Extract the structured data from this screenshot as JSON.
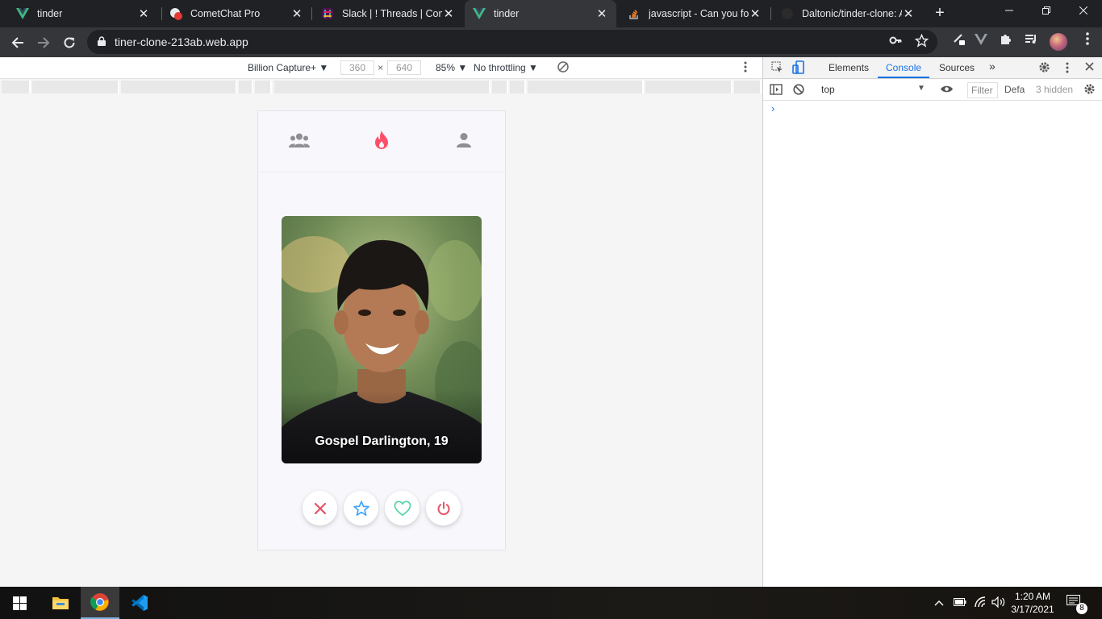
{
  "browser": {
    "tabs": [
      {
        "title": "tinder",
        "icon": "vue-icon",
        "active": false
      },
      {
        "title": "CometChat Pro",
        "icon": "cometchat-icon",
        "active": false
      },
      {
        "title": "Slack | ! Threads | Come",
        "icon": "slack-icon",
        "active": false
      },
      {
        "title": "tinder",
        "icon": "vue-icon",
        "active": true
      },
      {
        "title": "javascript - Can you for",
        "icon": "stackoverflow-icon",
        "active": false
      },
      {
        "title": "Daltonic/tinder-clone: A",
        "icon": "github-icon",
        "active": false
      }
    ],
    "close_glyph": "✕",
    "new_tab_glyph": "+",
    "url": "tiner-clone-213ab.web.app"
  },
  "device_toolbar": {
    "device": "Billion Capture+",
    "width": "360",
    "height": "640",
    "times": "×",
    "zoom": "85%",
    "throttling": "No throttling"
  },
  "app": {
    "card_name": "Gospel Darlington, 19",
    "colors": {
      "brand": "#fd5068",
      "nope": "#e25566",
      "star": "#3ca4ff",
      "like": "#53d3a2",
      "power": "#e25566"
    }
  },
  "devtools": {
    "tabs": [
      "Elements",
      "Console",
      "Sources"
    ],
    "more": "»",
    "context": "top",
    "filter_placeholder": "Filter",
    "levels": "Defa",
    "hidden": "3 hidden",
    "prompt": "›"
  },
  "taskbar": {
    "time": "1:20 AM",
    "date": "3/17/2021",
    "notifications": "8"
  }
}
